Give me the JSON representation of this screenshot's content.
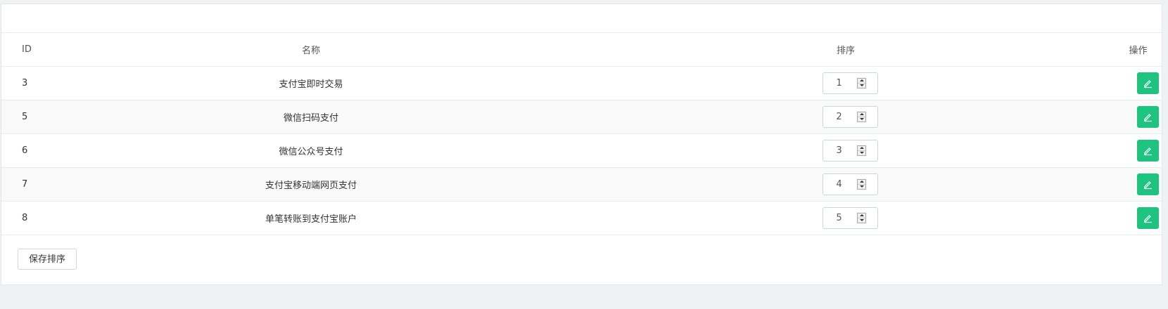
{
  "table": {
    "headers": {
      "id": "ID",
      "name": "名称",
      "sort": "排序",
      "action": "操作"
    },
    "rows": [
      {
        "id": "3",
        "name": "支付宝即时交易",
        "sort": "1"
      },
      {
        "id": "5",
        "name": "微信扫码支付",
        "sort": "2"
      },
      {
        "id": "6",
        "name": "微信公众号支付",
        "sort": "3"
      },
      {
        "id": "7",
        "name": "支付宝移动端网页支付",
        "sort": "4"
      },
      {
        "id": "8",
        "name": "单笔转账到支付宝账户",
        "sort": "5"
      }
    ]
  },
  "footer": {
    "save_label": "保存排序"
  },
  "colors": {
    "page_background": "#eff2f5",
    "edit_button": "#1cc47f"
  },
  "icons": {
    "edit": "pencil-icon",
    "spinner_up": "caret-up-icon",
    "spinner_down": "caret-down-icon"
  }
}
